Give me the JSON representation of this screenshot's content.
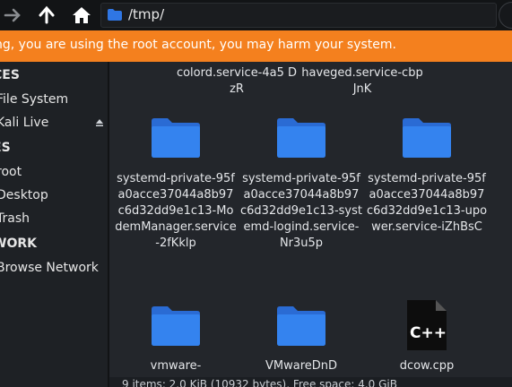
{
  "toolbar": {
    "path": "/tmp/"
  },
  "warning": "ng, you are using the root account, you may harm your system.",
  "sidebar": {
    "sections": [
      {
        "heading": "CES",
        "items": [
          "File System",
          "Kali Live"
        ]
      },
      {
        "heading": "ES",
        "items": [
          "root",
          "Desktop",
          "Trash"
        ]
      },
      {
        "heading": "WORK",
        "items": [
          "Browse Network"
        ]
      }
    ]
  },
  "files": [
    {
      "name": "colord.service-4a5 DzR",
      "type": "folder-partial"
    },
    {
      "name": "haveged.service-cbpJnK",
      "type": "folder-partial"
    },
    {
      "name": "systemd-private-95fa0acce37044a8b97c6d32dd9e1c13-ModemManager.service-2fKklp",
      "type": "folder"
    },
    {
      "name": "systemd-private-95fa0acce37044a8b97c6d32dd9e1c13-systemd-logind.service-Nr3u5p",
      "type": "folder"
    },
    {
      "name": "systemd-private-95fa0acce37044a8b97c6d32dd9e1c13-upower.service-iZhBsC",
      "type": "folder"
    },
    {
      "name": "vmware-",
      "type": "folder"
    },
    {
      "name": "VMwareDnD",
      "type": "folder"
    },
    {
      "name": "dcow.cpp",
      "type": "cpp"
    }
  ],
  "status": "9 items: 2.0 KiB (10932 bytes), Free space: 4.0 GiB",
  "icons": {
    "back": "arrow-right-icon",
    "up": "arrow-up-icon",
    "home": "home-icon",
    "folder_color": "#2f76e4",
    "warning_color": "#f4801e"
  }
}
